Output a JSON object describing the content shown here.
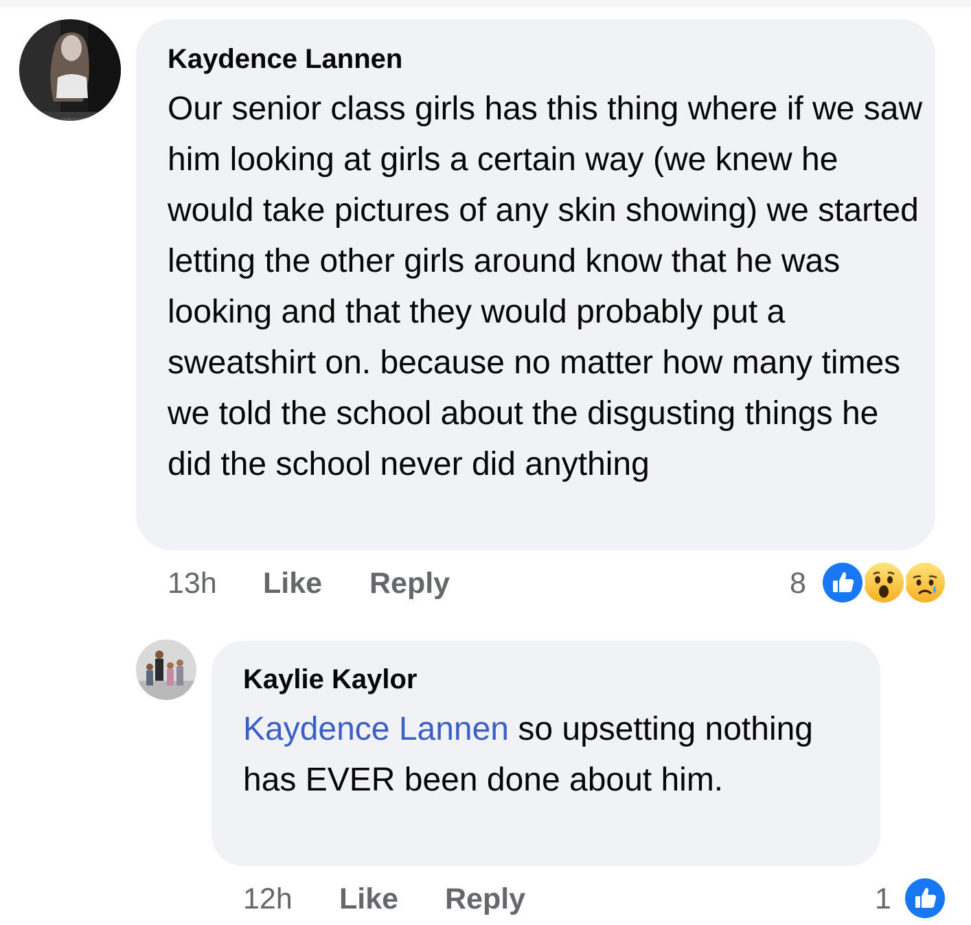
{
  "comments": [
    {
      "author": "Kaydence Lannen",
      "text": "Our senior class girls has this thing where if we saw him looking at girls a certain way (we knew he would take pictures of any skin showing) we started letting the other girls around know that he was looking and that they would probably put a sweatshirt on. because no matter how many times we told the school about the disgusting things he did the school never did anything",
      "time": "13h",
      "like_label": "Like",
      "reply_label": "Reply",
      "reaction_count": "8",
      "reactions": [
        "like-icon",
        "wow-icon",
        "sad-icon"
      ],
      "avatar_icon": "profile-photo-icon"
    },
    {
      "author": "Kaylie Kaylor",
      "mention": "Kaydence Lannen",
      "text": "so upsetting nothing has EVER been done about him.",
      "time": "12h",
      "like_label": "Like",
      "reply_label": "Reply",
      "reaction_count": "1",
      "reactions": [
        "like-icon"
      ],
      "avatar_icon": "profile-photo-icon"
    }
  ],
  "colors": {
    "bubble": "#f0f2f5",
    "mention": "#3b5fc8",
    "meta": "#65676b",
    "like_blue": "#1877f2"
  }
}
